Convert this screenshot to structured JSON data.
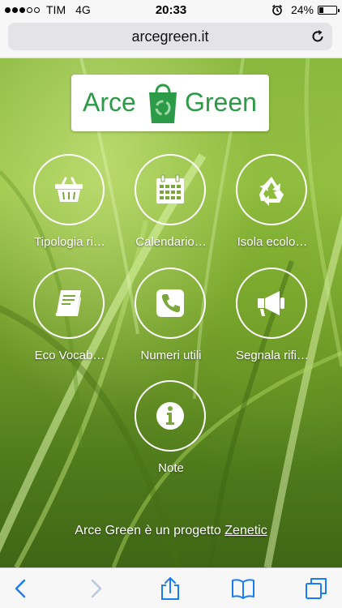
{
  "status_bar": {
    "carrier": "TIM",
    "network": "4G",
    "time": "20:33",
    "battery": "24%",
    "battery_level": 0.24,
    "signal_strength": 3,
    "signal_max": 5,
    "icons": [
      "alarm-icon",
      "battery-icon"
    ]
  },
  "browser": {
    "url": "arcegreen.it",
    "icons": [
      "reload-icon"
    ]
  },
  "page": {
    "logo": {
      "word_left": "Arce",
      "word_right": "Green",
      "icon": "shopping-bag-icon",
      "color": "#2c9a46"
    },
    "tiles": [
      {
        "label": "Tipologia ri…",
        "icon": "basket-icon"
      },
      {
        "label": "Calendario…",
        "icon": "calendar-icon"
      },
      {
        "label": "Isola ecolo…",
        "icon": "recycle-icon"
      },
      {
        "label": "Eco Vocab…",
        "icon": "book-icon"
      },
      {
        "label": "Numeri utili",
        "icon": "phone-icon"
      },
      {
        "label": "Segnala rifi…",
        "icon": "megaphone-icon"
      },
      {
        "label": "Note",
        "icon": "info-icon"
      }
    ],
    "footer": {
      "text": "Arce Green è un progetto ",
      "link": "Zenetic"
    }
  },
  "toolbar": {
    "icons": [
      "back-icon",
      "forward-icon",
      "share-icon",
      "bookmarks-icon",
      "tabs-icon"
    ],
    "accent": "#1a7cf5",
    "disabled": "#b9c9dc"
  }
}
